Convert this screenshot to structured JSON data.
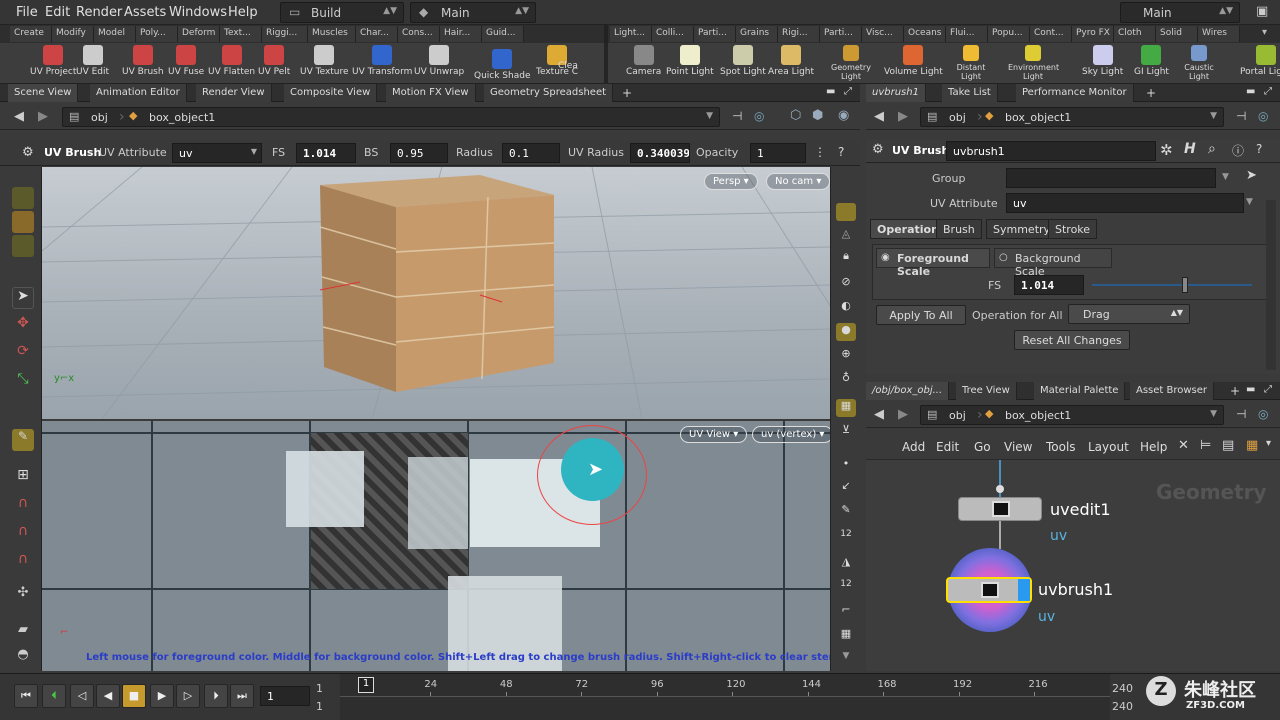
{
  "menu": {
    "file": "File",
    "edit": "Edit",
    "render": "Render",
    "assets": "Assets",
    "windows": "Windows",
    "help": "Help",
    "desktop": "Build",
    "context": "Main",
    "context2": "Main"
  },
  "shelf_tabs_left": [
    "Create",
    "Modify",
    "Model",
    "Poly...",
    "Deform",
    "Text...",
    "Riggi...",
    "Muscles",
    "Char...",
    "Cons...",
    "Hair...",
    "Guid..."
  ],
  "shelf_tabs_right": [
    "Light...",
    "Colli...",
    "Parti...",
    "Grains",
    "Rigi...",
    "Parti...",
    "Visc...",
    "Oceans",
    "Flui...",
    "Popu...",
    "Cont...",
    "Pyro FX",
    "Cloth",
    "Solid",
    "Wires"
  ],
  "tools_left": [
    "UV Project",
    "UV Edit",
    "UV Brush",
    "UV Fuse",
    "UV Flatten",
    "UV Pelt",
    "UV Texture",
    "UV Transform",
    "UV Unwrap",
    "Quick Shade",
    "Texture C"
  ],
  "tools_left_extra": "Clea",
  "tools_right": [
    "Camera",
    "Point Light",
    "Spot Light",
    "Area Light",
    "Geometry Light",
    "Volume Light",
    "Distant Light",
    "Environment Light",
    "Sky Light",
    "GI Light",
    "Caustic Light",
    "Portal Light"
  ],
  "left_tabs": [
    "Scene View",
    "Animation Editor",
    "Render View",
    "Composite View",
    "Motion FX View",
    "Geometry Spreadsheet"
  ],
  "path": {
    "obj": "obj",
    "node": "box_object1"
  },
  "opbar": {
    "title": "UV Brush",
    "attr_label": "UV Attribute",
    "attr_value": "uv",
    "fs_label": "FS",
    "fs_value": "1.014",
    "bs_label": "BS",
    "bs_value": "0.95",
    "radius_label": "Radius",
    "radius_value": "0.1",
    "uvradius_label": "UV Radius",
    "uvradius_value": "0.340039",
    "opacity_label": "Opacity",
    "opacity_value": "1"
  },
  "viewport": {
    "persp": "Persp",
    "cam": "No cam",
    "uvview": "UV View",
    "uvvertex": "uv (vertex)",
    "hint": "Left mouse for foreground color. Middle for background color. Shift+Left drag to change brush radius. Shift+Right-click to clear stencil."
  },
  "right_tabs": [
    "uvbrush1",
    "Take List",
    "Performance Monitor"
  ],
  "params": {
    "type": "UV Brush",
    "name": "uvbrush1",
    "group_label": "Group",
    "group_value": "",
    "uvattr_label": "UV Attribute",
    "uvattr_value": "uv",
    "tabs": [
      "Operation",
      "Brush",
      "Symmetry",
      "Stroke"
    ],
    "fg": "Foreground Scale",
    "bg": "Background Scale",
    "fs_label": "FS",
    "fs_value": "1.014",
    "fs_fraction": 0.58,
    "apply_all": "Apply To All",
    "op_for_all": "Operation for All",
    "op_value": "Drag",
    "reset": "Reset All Changes"
  },
  "net_tabs": [
    "/obj/box_obj...",
    "Tree View",
    "Material Palette",
    "Asset Browser"
  ],
  "net_menu": [
    "Add",
    "Edit",
    "Go",
    "View",
    "Tools",
    "Layout",
    "Help"
  ],
  "network": {
    "context_label": "Geometry",
    "node1": "uvedit1",
    "node1_attr": "uv",
    "node2": "uvbrush1",
    "node2_attr": "uv"
  },
  "timeline": {
    "frame": "1",
    "range_start": "1",
    "range_start2": "1",
    "current": "1",
    "ticks": [
      "24",
      "48",
      "72",
      "96",
      "120",
      "144",
      "168",
      "192",
      "216"
    ],
    "end": "240",
    "end2": "240"
  },
  "watermark": {
    "cn": "朱峰社区",
    "url": "ZF3D.COM"
  }
}
